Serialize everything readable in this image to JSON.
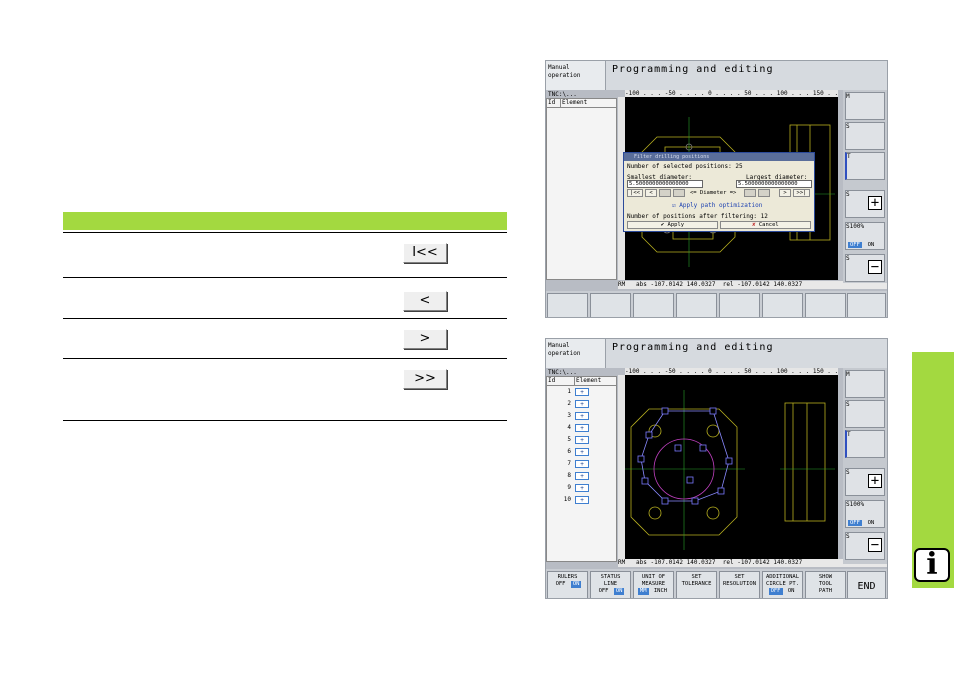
{
  "manual_table": {
    "rows": [
      {
        "key": "I<<"
      },
      {
        "key": "<"
      },
      {
        "key": ">"
      },
      {
        "key": ">>"
      }
    ]
  },
  "screen_top": {
    "mode": "Manual\noperation",
    "title": "Programming and editing",
    "path": "TNC:\\...",
    "list_headers": [
      "Id",
      "Element"
    ],
    "ruler_text": "-100 . . . -50 . . . . 0 . . . . 50 . . . 100 . . . 150 . . . 200",
    "coords": "RM   abs -107.0142 140.0327  rel -107.0142 140.0327",
    "dialog": {
      "title": "Filter drilling positions",
      "selected_count": "Number of selected positions: 25",
      "smallest_label": "Smallest diameter:",
      "largest_label": "Largest diameter:",
      "smallest_value": "5.5000000000000000",
      "largest_value": "5.5000000000000000",
      "nav_first": "|<<",
      "nav_prev": "<",
      "diameter_label": "<= Diameter =>",
      "nav_next": ">",
      "nav_last": ">>|",
      "apply_path": "Apply path optimization",
      "after_filter": "Number of positions after filtering: 12",
      "apply_btn": "Apply",
      "cancel_btn": "Cancel"
    }
  },
  "screen_bottom": {
    "mode": "Manual\noperation",
    "title": "Programming and editing",
    "path": "TNC:\\...",
    "list_headers": [
      "Id",
      "Element"
    ],
    "list_ids": [
      "1",
      "2",
      "3",
      "4",
      "5",
      "6",
      "7",
      "8",
      "9",
      "10"
    ],
    "coords": "RM   abs -107.0142 140.0327  rel -107.0142 140.0327",
    "softkeys": {
      "rulers": "RULERS",
      "status_line": "STATUS\nLINE",
      "unit": "UNIT OF\nMEASURE",
      "set_tolerance": "SET\nTOLERANCE",
      "set_resolution": "SET\nRESOLUTION",
      "additional_circle": "ADDITIONAL\nCIRCLE PT.",
      "show_tool_path": "SHOW\nTOOL\nPATH",
      "end": "END",
      "off": "OFF",
      "on": "ON",
      "mm": "MM",
      "inch": "INCH"
    }
  },
  "side_panel": {
    "labels": [
      "M",
      "S",
      "T",
      "S",
      "S100%",
      "S"
    ],
    "off": "OFF",
    "on": "ON"
  },
  "info_badge": "i",
  "colors": {
    "accent_green": "#a3d940",
    "toggle_on": "#3f7fd0"
  }
}
